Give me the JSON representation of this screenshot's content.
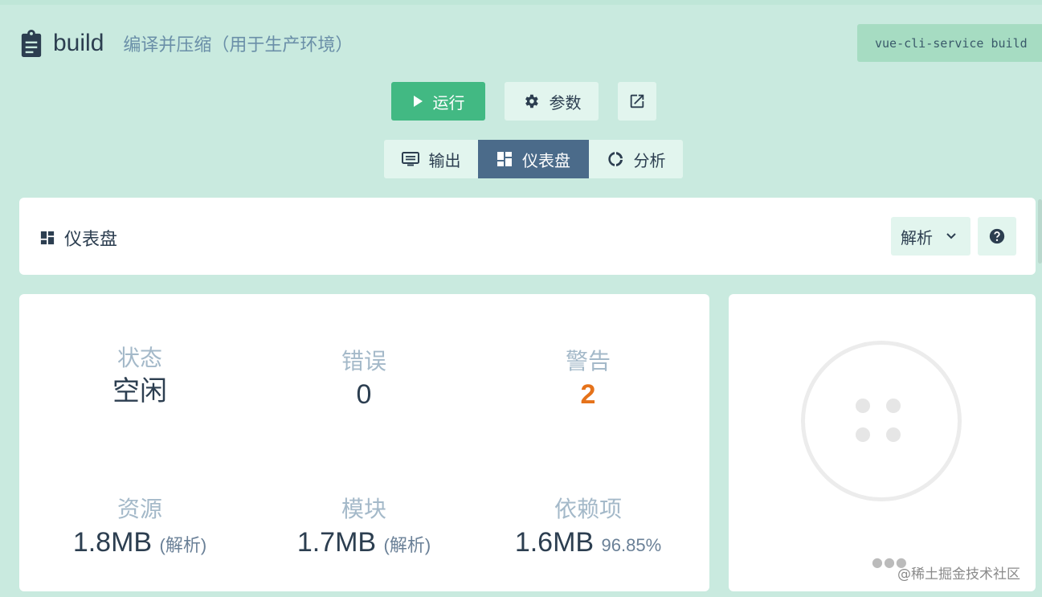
{
  "task": {
    "name": "build",
    "description": "编译并压缩（用于生产环境）",
    "command": "vue-cli-service build"
  },
  "actions": {
    "run_label": "运行",
    "params_label": "参数"
  },
  "tabs": [
    {
      "label": "输出"
    },
    {
      "label": "仪表盘"
    },
    {
      "label": "分析"
    }
  ],
  "panel": {
    "title": "仪表盘",
    "mode_select": "解析"
  },
  "stats": {
    "status": {
      "label": "状态",
      "value": "空闲"
    },
    "errors": {
      "label": "错误",
      "value": "0"
    },
    "warnings": {
      "label": "警告",
      "value": "2"
    },
    "assets": {
      "label": "资源",
      "value": "1.8MB",
      "note": "(解析)"
    },
    "modules": {
      "label": "模块",
      "value": "1.7MB",
      "note": "(解析)"
    },
    "dependencies": {
      "label": "依赖项",
      "value": "1.6MB",
      "note": "96.85%"
    }
  },
  "watermark": "@稀土掘金技术社区",
  "colors": {
    "background": "#c9eadf",
    "accent_green": "#42b983",
    "active_tab": "#4b6b8a",
    "warning": "#e5721a"
  },
  "icons": {
    "task": "clipboard-icon",
    "run": "play-icon",
    "params": "gear-icon",
    "open": "open-external-icon",
    "output": "terminal-icon",
    "dashboard": "dashboard-icon",
    "analysis": "donut-chart-icon",
    "dropdown": "chevron-down-icon",
    "help": "help-circle-icon"
  }
}
